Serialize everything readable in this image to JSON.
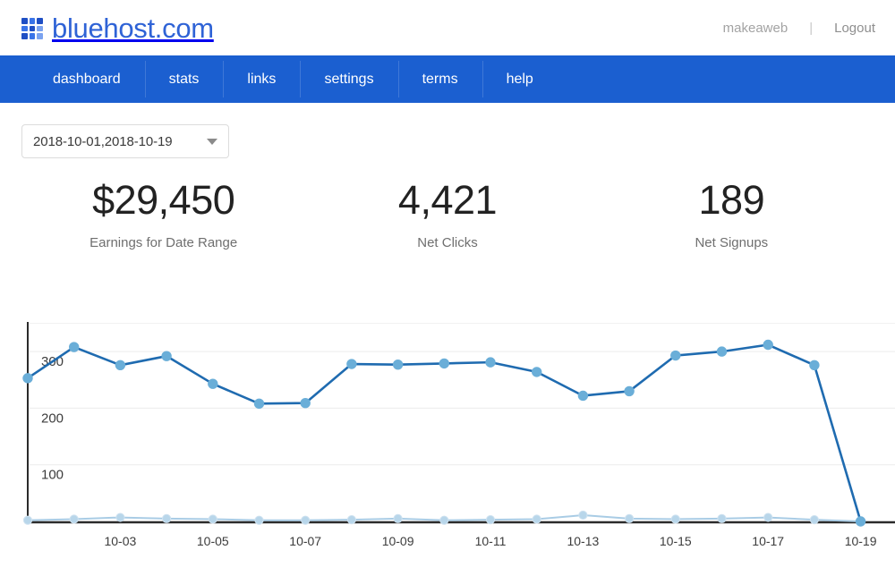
{
  "header": {
    "brand": "bluehost.com",
    "logo_icon": "grid-logo-icon",
    "user_name": "makeaweb",
    "separator": "|",
    "logout_label": "Logout",
    "brand_color": "#2f63d6"
  },
  "nav": {
    "background_color": "#1b5fd0",
    "items": [
      {
        "label": "dashboard"
      },
      {
        "label": "stats"
      },
      {
        "label": "links"
      },
      {
        "label": "settings"
      },
      {
        "label": "terms"
      },
      {
        "label": "help"
      }
    ]
  },
  "date_range": {
    "value": "2018-10-01,2018-10-19",
    "caret_icon": "chevron-down-icon"
  },
  "kpis": [
    {
      "value": "$29,450",
      "label": "Earnings for Date Range"
    },
    {
      "value": "4,421",
      "label": "Net Clicks"
    },
    {
      "value": "189",
      "label": "Net Signups"
    }
  ],
  "chart_data": {
    "type": "line",
    "title": "",
    "xlabel": "",
    "ylabel": "",
    "grid": true,
    "legend": "none",
    "ylim": [
      0,
      350
    ],
    "yticks": [
      100,
      200,
      300
    ],
    "x": [
      "10-01",
      "10-02",
      "10-03",
      "10-04",
      "10-05",
      "10-06",
      "10-07",
      "10-08",
      "10-09",
      "10-10",
      "10-11",
      "10-12",
      "10-13",
      "10-14",
      "10-15",
      "10-16",
      "10-17",
      "10-18",
      "10-19"
    ],
    "xticks": [
      "10-03",
      "10-05",
      "10-07",
      "10-09",
      "10-11",
      "10-13",
      "10-15",
      "10-17",
      "10-19"
    ],
    "series": [
      {
        "name": "Clicks",
        "color": "#1f6bb0",
        "point_color": "#6aaed8",
        "values": [
          253,
          308,
          276,
          292,
          243,
          208,
          209,
          278,
          277,
          279,
          281,
          264,
          222,
          230,
          293,
          300,
          312,
          276,
          0
        ]
      },
      {
        "name": "Signups",
        "color": "#a9cce5",
        "point_color": "#b8d6ea",
        "values": [
          2,
          4,
          7,
          5,
          4,
          2,
          2,
          3,
          5,
          2,
          3,
          4,
          11,
          5,
          4,
          5,
          7,
          3,
          0
        ]
      }
    ]
  }
}
